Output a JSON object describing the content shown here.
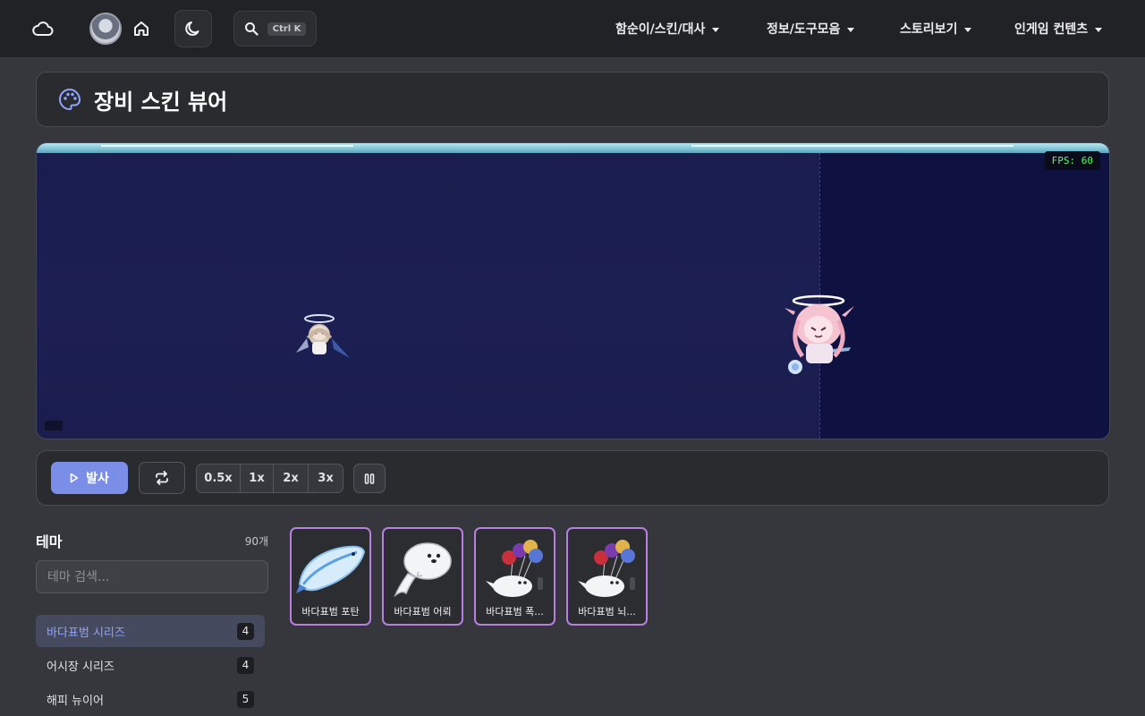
{
  "nav": {
    "menus": [
      {
        "label": "함순이/스킨/대사"
      },
      {
        "label": "정보/도구모음"
      },
      {
        "label": "스토리보기"
      },
      {
        "label": "인게임 컨텐츠"
      }
    ],
    "search_shortcut": "Ctrl K",
    "icons": [
      "cloud-icon",
      "avatar",
      "home-icon",
      "moon-icon",
      "search-icon"
    ]
  },
  "page": {
    "title": "장비 스킨 뷰어",
    "title_icon": "palette-icon"
  },
  "viewer": {
    "fps_text": "FPS: 60"
  },
  "controls": {
    "fire_label": "발사",
    "speeds": [
      "0.5x",
      "1x",
      "2x",
      "3x"
    ],
    "icons": [
      "play-icon",
      "repeat-icon",
      "pause-icon"
    ]
  },
  "sidebar": {
    "title": "테마",
    "count": "90개",
    "search_placeholder": "테마 검색...",
    "items": [
      {
        "label": "바다표범 시리즈",
        "count": "4",
        "active": true
      },
      {
        "label": "어시장 시리즈",
        "count": "4",
        "active": false
      },
      {
        "label": "해피 뉴이어",
        "count": "5",
        "active": false
      }
    ]
  },
  "skins": [
    {
      "label": "바다표범 포탄"
    },
    {
      "label": "바다표범 어뢰"
    },
    {
      "label": "바다표범 폭..."
    },
    {
      "label": "바다표범 뇌..."
    }
  ],
  "colors": {
    "accent": "#7a8ee8",
    "card_border": "#b77fe0",
    "active_theme_text": "#8ea2ff",
    "fps_text": "#4dff64"
  }
}
